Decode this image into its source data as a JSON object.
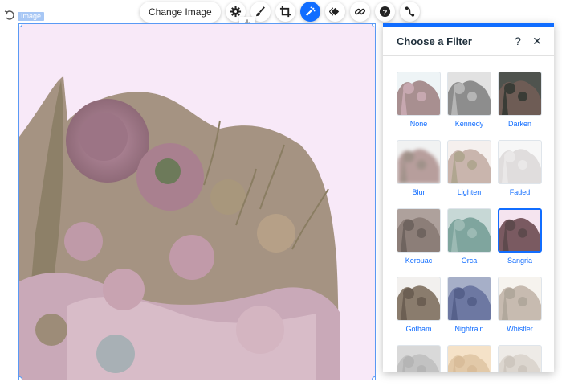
{
  "selection_tag": "Image",
  "toolbar": {
    "change_image_label": "Change Image",
    "icons": [
      "settings-icon",
      "brush-icon",
      "crop-icon",
      "filter-magic-icon",
      "animation-icon",
      "link-icon",
      "help-icon",
      "connect-icon"
    ],
    "active_icon": "filter-magic-icon"
  },
  "panel": {
    "title": "Choose a Filter",
    "help_label": "?",
    "close_label": "✕",
    "selected_filter": "Sangria",
    "filters": [
      {
        "name": "None"
      },
      {
        "name": "Kennedy"
      },
      {
        "name": "Darken"
      },
      {
        "name": "Blur"
      },
      {
        "name": "Lighten"
      },
      {
        "name": "Faded"
      },
      {
        "name": "Kerouac"
      },
      {
        "name": "Orca"
      },
      {
        "name": "Sangria"
      },
      {
        "name": "Gotham"
      },
      {
        "name": "Nightrain"
      },
      {
        "name": "Whistler"
      },
      {
        "name": ""
      },
      {
        "name": ""
      },
      {
        "name": ""
      }
    ]
  },
  "colors": {
    "accent": "#116dff",
    "canvas_bg": "#f8e9f8",
    "selection_border": "#5a9af5"
  }
}
